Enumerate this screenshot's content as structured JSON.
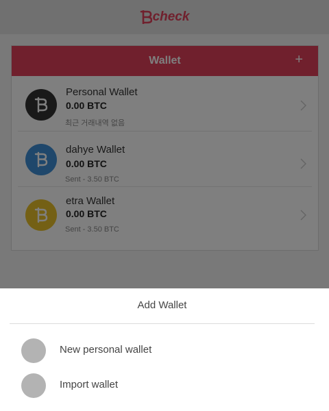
{
  "app": {
    "logo_text": "check"
  },
  "wallet_card": {
    "title": "Wallet",
    "add_label": "+",
    "items": [
      {
        "name": "Personal Wallet",
        "balance": "0.00 BTC",
        "status": "최근 거래내역 없음",
        "coin_color": "#333333"
      },
      {
        "name": "dahye Wallet",
        "balance": "0.00 BTC",
        "status": "Sent - 3.50 BTC",
        "coin_color": "#3f8fd6"
      },
      {
        "name": "etra Wallet",
        "balance": "0.00 BTC",
        "status": "Sent - 3.50 BTC",
        "coin_color": "#e8c12a"
      }
    ]
  },
  "sheet": {
    "title": "Add Wallet",
    "options": [
      {
        "label": "New personal wallet"
      },
      {
        "label": "Import wallet"
      }
    ]
  },
  "colors": {
    "accent": "#e0405a",
    "topbar": "#e0e0e0"
  }
}
